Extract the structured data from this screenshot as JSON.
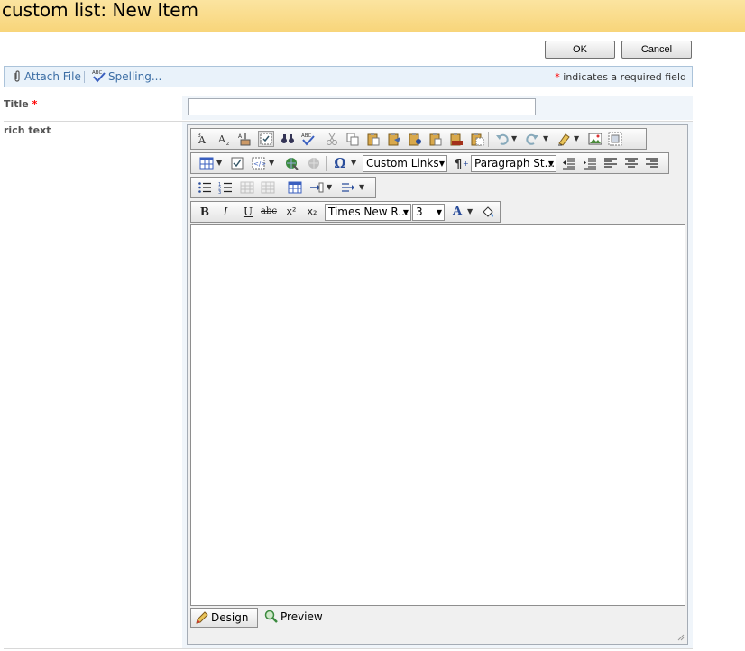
{
  "window": {
    "title": "custom list: New Item"
  },
  "actions": {
    "ok_label": "OK",
    "cancel_label": "Cancel"
  },
  "toolbar": {
    "attach_label": "Attach File",
    "spelling_label": "Spelling...",
    "required_star": "*",
    "required_note": "indicates a required field"
  },
  "form": {
    "title_label": "Title",
    "title_required": "*",
    "title_value": "",
    "rich_label": "rich text"
  },
  "editor": {
    "style_combo": "Custom Links",
    "paragraph_combo": "Paragraph St...",
    "font_combo": "Times New R...",
    "size_combo": "3",
    "bold": "B",
    "italic": "I",
    "underline": "U",
    "strike": "abc",
    "superscript": "x²",
    "subscript": "x₂",
    "font_color": "A",
    "omega": "Ω",
    "design_label": "Design",
    "preview_label": "Preview"
  },
  "colors": {
    "accent": "#f8d57a",
    "toolbar_bg": "#e9f2fa",
    "link": "#3b6da4",
    "required": "#ff0000"
  }
}
